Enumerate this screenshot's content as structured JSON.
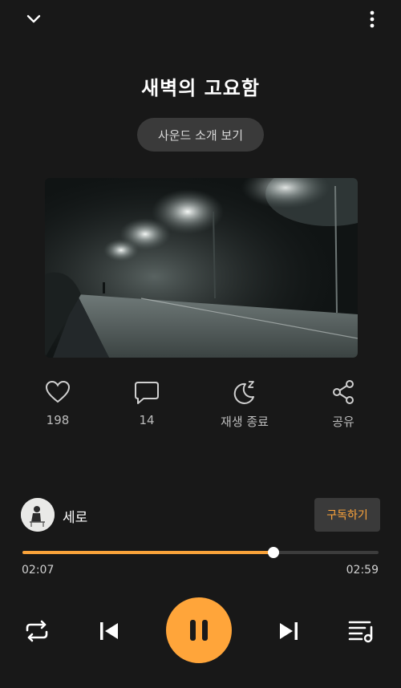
{
  "header": {
    "collapse_icon": "chevron-down-icon",
    "menu_icon": "more-vertical-icon"
  },
  "track": {
    "title": "새벽의 고요함",
    "sound_intro_label": "사운드 소개 보기"
  },
  "actions": {
    "like_count": "198",
    "comment_count": "14",
    "sleep_label": "재생 종료",
    "share_label": "공유"
  },
  "artist": {
    "name": "세로",
    "subscribe_label": "구독하기"
  },
  "playback": {
    "elapsed": "02:07",
    "duration": "02:59",
    "progress": 0.705,
    "state": "playing"
  },
  "controls": {
    "repeat_icon": "repeat-icon",
    "prev_icon": "skip-previous-icon",
    "pause_icon": "pause-icon",
    "next_icon": "skip-next-icon",
    "playlist_icon": "playlist-icon"
  },
  "colors": {
    "accent": "#ffa53a",
    "background": "#181818",
    "button_bg": "#3a3a3a"
  }
}
